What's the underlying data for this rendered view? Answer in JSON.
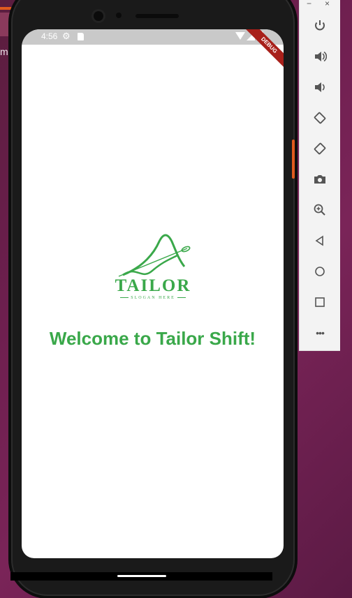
{
  "desktop": {
    "side_text": "me"
  },
  "status_bar": {
    "time": "4:56"
  },
  "debug_banner": "DEBUG",
  "logo": {
    "word": "TAILOR",
    "slogan": "SLOGAN HERE"
  },
  "welcome_text": "Welcome to Tailor Shift!",
  "toolbar": {
    "minimize": "−",
    "close": "×",
    "buttons": [
      {
        "icon": "power-icon"
      },
      {
        "icon": "volume-up-icon"
      },
      {
        "icon": "volume-down-icon"
      },
      {
        "icon": "rotate-left-icon"
      },
      {
        "icon": "rotate-right-icon"
      },
      {
        "icon": "camera-icon"
      },
      {
        "icon": "zoom-icon"
      },
      {
        "icon": "back-icon"
      },
      {
        "icon": "home-icon"
      },
      {
        "icon": "overview-icon"
      },
      {
        "icon": "more-icon",
        "label": "•••"
      }
    ]
  },
  "colors": {
    "accent": "#3aa84a",
    "debug": "#a8201a"
  }
}
